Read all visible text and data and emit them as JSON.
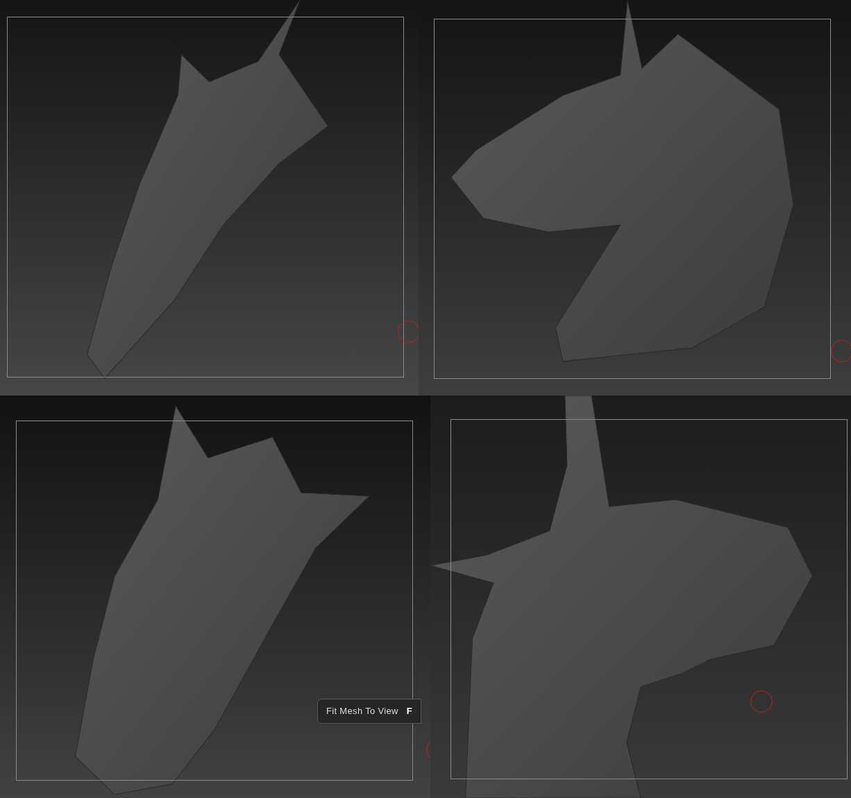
{
  "tooltip": {
    "label": "Fit Mesh To View",
    "shortcut": "F"
  }
}
